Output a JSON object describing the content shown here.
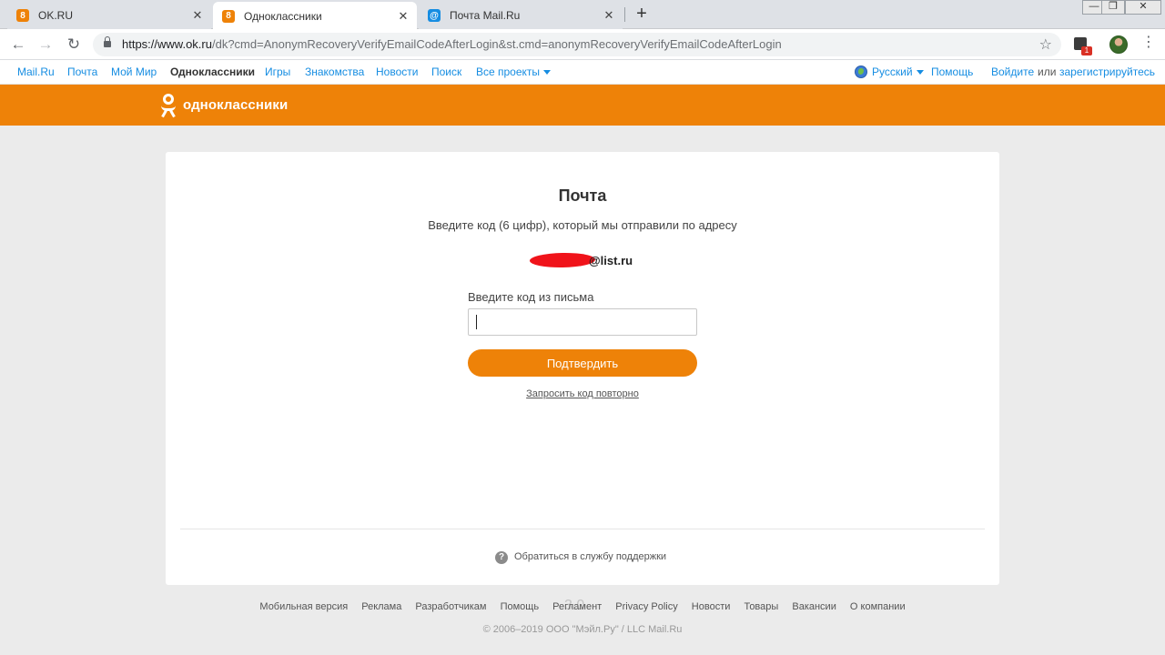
{
  "browser": {
    "tabs": [
      {
        "title": "OK.RU",
        "favicon": "ok-icon",
        "active": false
      },
      {
        "title": "Одноклассники",
        "favicon": "ok-icon",
        "active": true
      },
      {
        "title": "Почта Mail.Ru",
        "favicon": "mail-icon",
        "active": false
      }
    ],
    "new_tab": "+",
    "url_host": "https://www.ok.ru",
    "url_path": "/dk?cmd=AnonymRecoveryVerifyEmailCodeAfterLogin&st.cmd=anonymRecoveryVerifyEmailCodeAfterLogin",
    "extension_badge": "1",
    "window_controls": {
      "minimize": "—",
      "maximize": "❐",
      "close": "✕"
    }
  },
  "portal": {
    "links": [
      "Mail.Ru",
      "Почта",
      "Мой Мир",
      "Одноклассники",
      "Игры",
      "Знакомства",
      "Новости",
      "Поиск",
      "Все проекты"
    ],
    "current": "Одноклассники",
    "language": "Русский",
    "help": "Помощь",
    "login": "Войдите",
    "or": "или",
    "register": "зарегистрируйтесь"
  },
  "header": {
    "logo_text": "одноклассники",
    "brand_color": "#ee8208"
  },
  "card": {
    "title": "Почта",
    "subtitle": "Введите код (6 цифр), который мы отправили по адресу",
    "email_domain": "@list.ru",
    "field_label": "Введите код из письма",
    "input_value": "",
    "confirm_label": "Подтвердить",
    "resend_label": "Запросить код повторно",
    "support_label": "Обратиться в службу поддержки"
  },
  "footer": {
    "links": [
      "Мобильная версия",
      "Реклама",
      "Разработчикам",
      "Помощь",
      "Регламент",
      "Privacy Policy",
      "Новости",
      "Товары",
      "Вакансии",
      "О компании"
    ],
    "copyright": "© 2006–2019 ООО \"Мэйл.Ру\" / LLC Mail.Ru"
  },
  "overlay": {
    "watermark": "3.0"
  }
}
